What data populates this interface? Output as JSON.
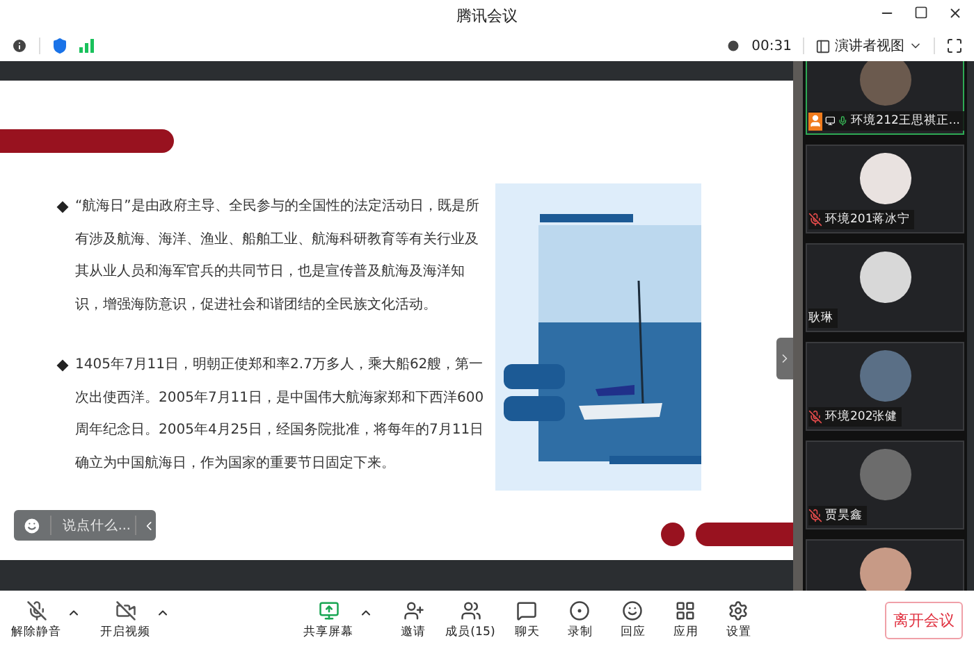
{
  "window": {
    "title": "腾讯会议"
  },
  "info_bar": {
    "timer": "00:31",
    "view_mode": "演讲者视图"
  },
  "slide": {
    "paragraphs": [
      "“航海日”是由政府主导、全民参与的全国性的法定活动日，既是所有涉及航海、海洋、渔业、船舶工业、航海科研教育等有关行业及其从业人员和海军官兵的共同节日，也是宣传普及航海及海洋知识，增强海防意识，促进社会和谐团结的全民族文化活动。",
      "1405年7月11日，明朝正使郑和率2.7万多人，乘大船62艘，第一次出使西洋。2005年7月11日，是中国伟大航海家郑和下西洋600周年纪念日。2005年4月25日，经国务院批准，将每年的7月11日确立为中国航海日，作为国家的重要节日固定下来。"
    ]
  },
  "chat_input": {
    "placeholder": "说点什么..."
  },
  "participants": [
    {
      "name": "环境212王思祺正...",
      "selected": true,
      "kind": "speaking",
      "host": true,
      "sharing": true
    },
    {
      "name": "环境201蒋冰宁",
      "selected": false,
      "kind": "muted",
      "host": false,
      "sharing": false
    },
    {
      "name": "耿琳",
      "selected": false,
      "kind": "silent",
      "host": false,
      "sharing": false
    },
    {
      "name": "环境202张健",
      "selected": false,
      "kind": "muted",
      "host": false,
      "sharing": false
    },
    {
      "name": "贾昊鑫",
      "selected": false,
      "kind": "muted",
      "host": false,
      "sharing": false
    }
  ],
  "toolbar": {
    "left": [
      {
        "label": "解除静音",
        "menu": true
      },
      {
        "label": "开启视频",
        "menu": true
      }
    ],
    "center": [
      {
        "label": "共享屏幕",
        "menu": true
      },
      {
        "label": "邀请",
        "menu": false
      },
      {
        "label": "成员(15)",
        "menu": false
      },
      {
        "label": "聊天",
        "menu": false
      },
      {
        "label": "录制",
        "menu": false
      },
      {
        "label": "回应",
        "menu": false
      },
      {
        "label": "应用",
        "menu": false
      },
      {
        "label": "设置",
        "menu": false
      }
    ],
    "leave": "离开会议"
  }
}
